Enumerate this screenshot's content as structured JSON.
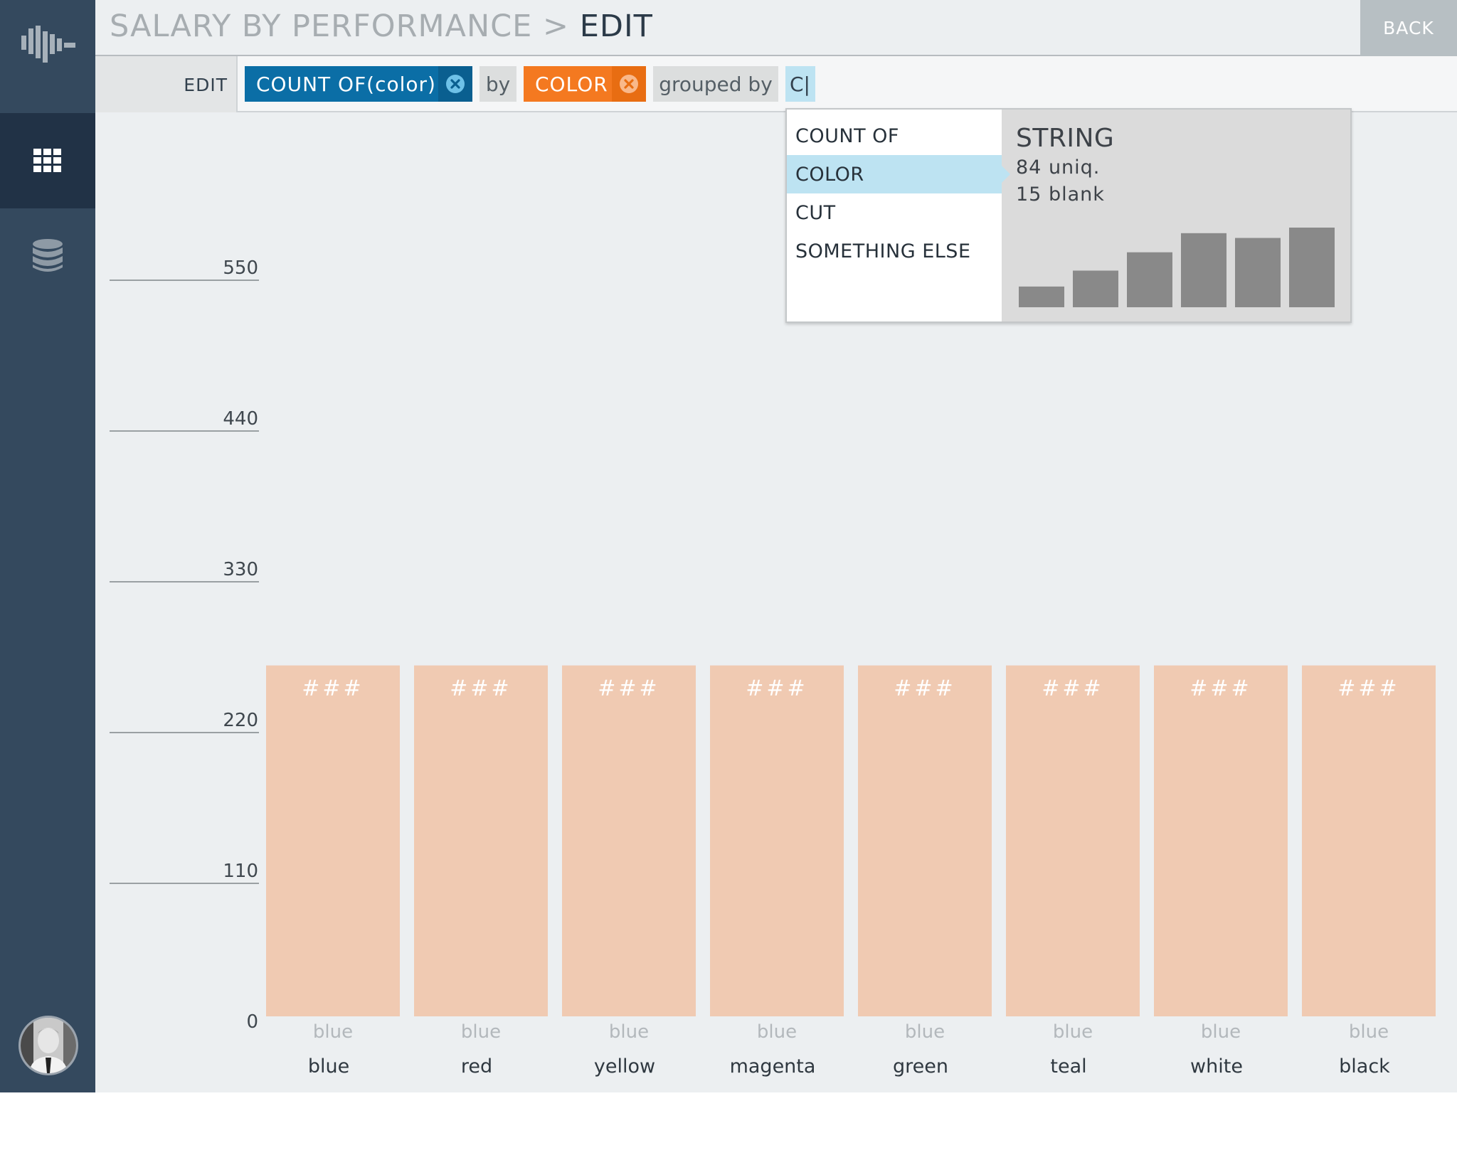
{
  "app": {
    "title": "SALARY BY PERFORMANCE",
    "title_separator": ">",
    "mode": "EDIT",
    "back_label": "BACK"
  },
  "sidebar": {
    "logo_icon": "waveform-logo-icon",
    "items": [
      {
        "name": "grid",
        "icon": "grid-icon",
        "active": true
      },
      {
        "name": "database",
        "icon": "database-icon",
        "active": false
      }
    ],
    "accent_color": "#f5822f"
  },
  "query": {
    "edit_label": "EDIT",
    "measure_pill": {
      "label": "COUNT OF(color)",
      "color": "#0b6ea6"
    },
    "by_label": "by",
    "dimension_pill": {
      "label": "COLOR",
      "color": "#f47920"
    },
    "grouped_label": "grouped by",
    "group_input_value": "C|"
  },
  "dropdown": {
    "items": [
      "COUNT OF",
      "COLOR",
      "CUT",
      "SOMETHING ELSE"
    ],
    "selected_index": 1,
    "preview": {
      "type": "STRING",
      "unique": "84 uniq.",
      "blank": "15 blank",
      "distribution": [
        0.26,
        0.46,
        0.69,
        0.93,
        0.87,
        1.0
      ]
    }
  },
  "chart_data": {
    "type": "bar",
    "ylim": [
      0,
      550
    ],
    "y_ticks": [
      0,
      110,
      220,
      330,
      440,
      550
    ],
    "categories": [
      "blue",
      "red",
      "yellow",
      "magenta",
      "green",
      "teal",
      "white",
      "black"
    ],
    "values": [
      256,
      256,
      256,
      256,
      256,
      256,
      256,
      256
    ],
    "data_labels": [
      "###",
      "###",
      "###",
      "###",
      "###",
      "###",
      "###",
      "###"
    ],
    "group_labels": [
      "blue",
      "blue",
      "blue",
      "blue",
      "blue",
      "blue",
      "blue",
      "blue"
    ],
    "bar_color": "#f0cab2",
    "grid": false
  }
}
